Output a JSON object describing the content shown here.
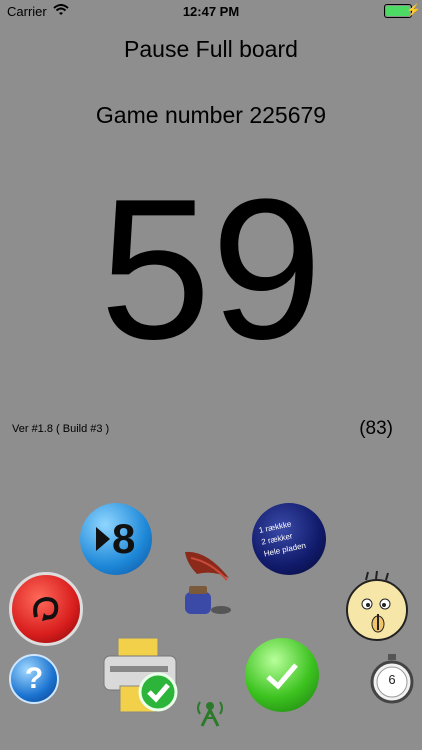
{
  "status_bar": {
    "carrier": "Carrier",
    "time": "12:47 PM"
  },
  "header": {
    "title": "Pause Full board"
  },
  "game": {
    "label": "Game number 225679",
    "current_number": "59",
    "version": "Ver #1.8 ( Build #3 )",
    "count": "(83)"
  },
  "buttons": {
    "next_number": "8",
    "rows_lines": [
      "1 rækkke",
      "2 rækker",
      "Hele pladen"
    ],
    "timer_value": "6"
  },
  "icons": [
    "wifi-icon",
    "battery-icon",
    "next-number-icon",
    "rows-mode-icon",
    "quill-ink-icon",
    "red-undo-icon",
    "help-icon",
    "print-icon",
    "antenna-icon",
    "confirm-icon",
    "quiet-face-icon",
    "stopwatch-icon"
  ]
}
